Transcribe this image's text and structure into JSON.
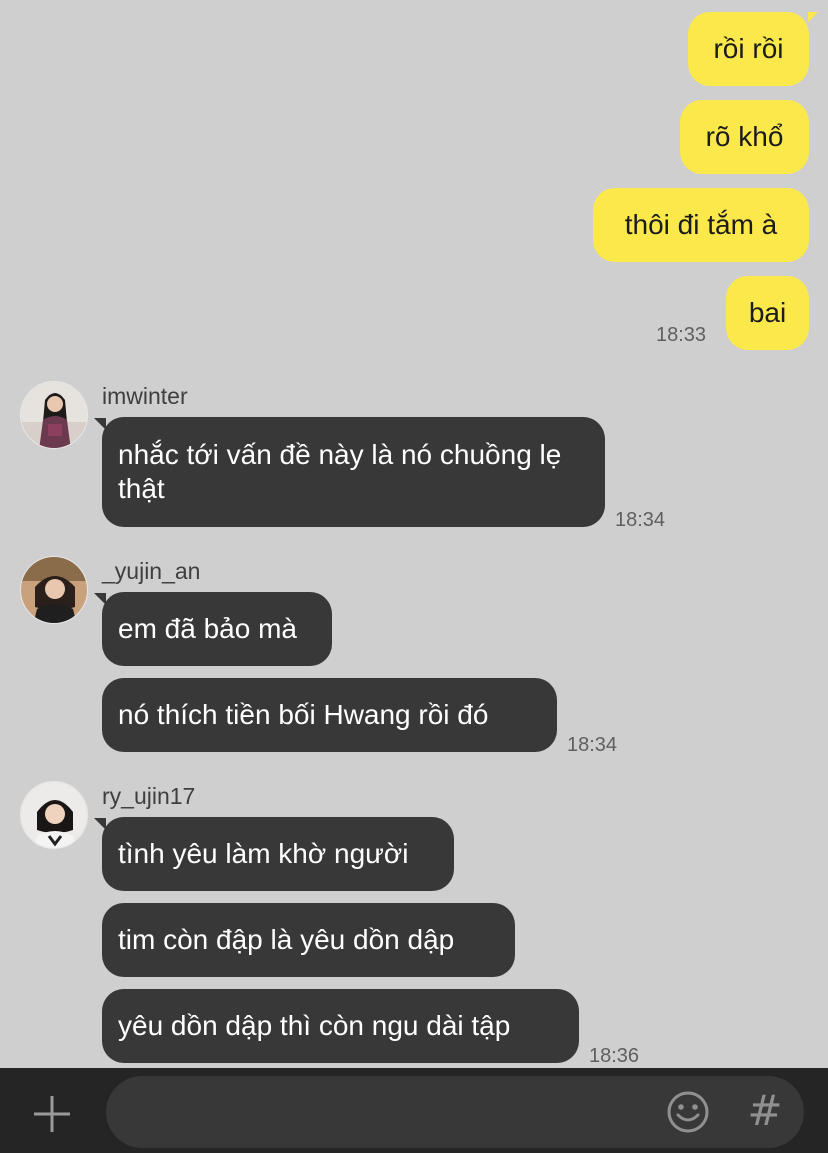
{
  "colors": {
    "background": "#cfcfcf",
    "outgoing_bubble": "#fbe84a",
    "incoming_bubble": "#383838",
    "bottom_bar": "#252525",
    "input_box": "#383838"
  },
  "outgoing": {
    "messages": [
      "rồi rồi",
      "rõ khổ",
      "thôi đi tắm à",
      "bai"
    ],
    "time": "18:33"
  },
  "groups": [
    {
      "sender": "imwinter",
      "messages": [
        "nhắc tới vấn đề này là nó chuồng lẹ thật"
      ],
      "time": "18:34"
    },
    {
      "sender": "_yujin_an",
      "messages": [
        "em đã bảo mà",
        "nó thích tiền bối Hwang rồi đó"
      ],
      "time": "18:34"
    },
    {
      "sender": "ry_ujin17",
      "messages": [
        "tình yêu làm khờ người",
        "tim còn đập là yêu dồn dập",
        "yêu dồn dập thì còn ngu dài tập"
      ],
      "time": "18:36"
    }
  ],
  "input": {
    "value": "",
    "placeholder": ""
  },
  "icons": {
    "plus": "plus-icon",
    "emoji": "emoji-icon",
    "hashtag_glyph": "#"
  }
}
